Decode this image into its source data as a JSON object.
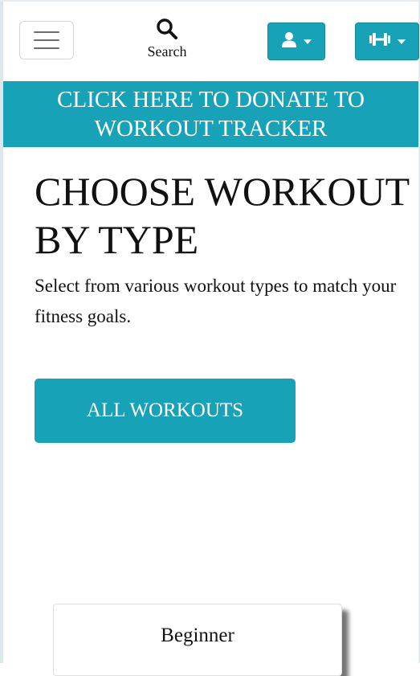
{
  "navbar": {
    "menu_icon": "hamburger-menu-icon",
    "search_label": "Search",
    "search_icon": "search-icon",
    "user_icon": "user-icon",
    "gym_icon": "dumbbell-icon",
    "accent_color": "#17a2b8"
  },
  "donate_banner": {
    "text": "CLICK HERE TO DONATE TO WORKOUT TRACKER"
  },
  "hero": {
    "title": "CHOOSE WORKOUT BY TYPE",
    "description": "Select from various workout types to match your fitness goals.",
    "button_label": "ALL WORKOUTS"
  },
  "cards": [
    {
      "title": "Beginner"
    }
  ]
}
